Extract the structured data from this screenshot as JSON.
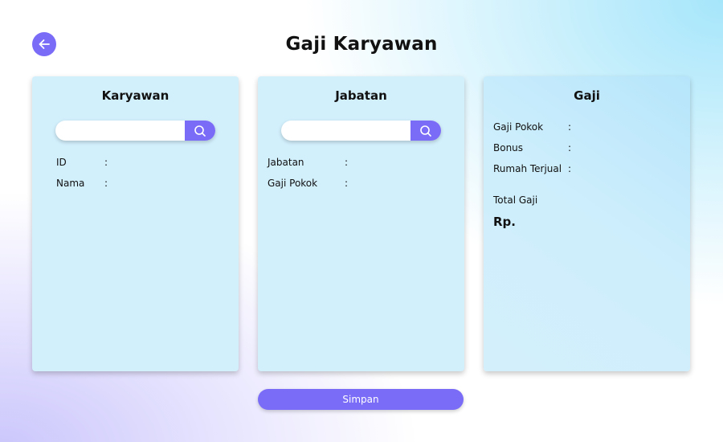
{
  "header": {
    "title": "Gaji Karyawan"
  },
  "karyawan": {
    "title": "Karyawan",
    "search_value": "",
    "fields": [
      {
        "label": "ID",
        "sep": ":"
      },
      {
        "label": "Nama",
        "sep": ":"
      }
    ]
  },
  "jabatan": {
    "title": "Jabatan",
    "search_value": "",
    "fields": [
      {
        "label": "Jabatan",
        "sep": ":"
      },
      {
        "label": "Gaji Pokok",
        "sep": ":"
      }
    ]
  },
  "gaji": {
    "title": "Gaji",
    "fields": [
      {
        "label": "Gaji Pokok",
        "sep": ":"
      },
      {
        "label": "Bonus",
        "sep": ":"
      },
      {
        "label": "Rumah Terjual",
        "sep": ":"
      }
    ],
    "total_label": "Total Gaji",
    "total_prefix": "Rp."
  },
  "actions": {
    "save_label": "Simpan"
  },
  "colors": {
    "accent": "#7a6cf7",
    "card": "#d2effc"
  }
}
